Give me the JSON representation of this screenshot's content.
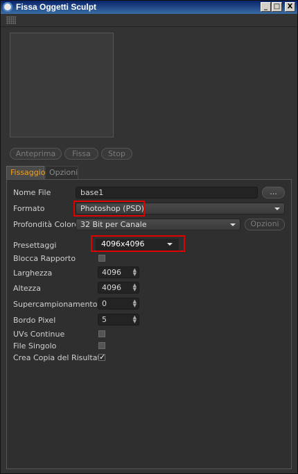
{
  "window": {
    "title": "Fissa Oggetti Sculpt"
  },
  "titlebar_buttons": {
    "minimize": "_",
    "maximize": "□",
    "close": "X"
  },
  "actions": {
    "preview": "Anteprima",
    "bake": "Fissa",
    "stop": "Stop"
  },
  "tabs": [
    {
      "label": "Fissaggio",
      "active": true
    },
    {
      "label": "Opzioni",
      "active": false
    }
  ],
  "form": {
    "file_name": {
      "label": "Nome File",
      "value": "base1",
      "browse": "..."
    },
    "format": {
      "label": "Formato",
      "value": "Photoshop (PSD)"
    },
    "depth": {
      "label": "Profondità Colore",
      "value": "32 Bit per Canale",
      "options_button": "Opzioni"
    },
    "presets": {
      "label": "Presettaggi",
      "value": "4096x4096"
    },
    "lock_ratio": {
      "label": "Blocca Rapporto",
      "checked": false
    },
    "width": {
      "label": "Larghezza",
      "value": "4096"
    },
    "height": {
      "label": "Altezza",
      "value": "4096"
    },
    "supersampling": {
      "label": "Supercampionamento",
      "value": "0"
    },
    "pixel_border": {
      "label": "Bordo Pixel",
      "value": "5"
    },
    "continuous_uvs": {
      "label": "UVs Continue",
      "checked": false
    },
    "single_file": {
      "label": "File Singolo",
      "checked": false
    },
    "copy_result": {
      "label": "Crea Copia del Risultato",
      "checked": true
    }
  },
  "colors": {
    "highlight": "#e00000",
    "active_tab": "#f0a020",
    "titlebar": "#0a246a"
  }
}
